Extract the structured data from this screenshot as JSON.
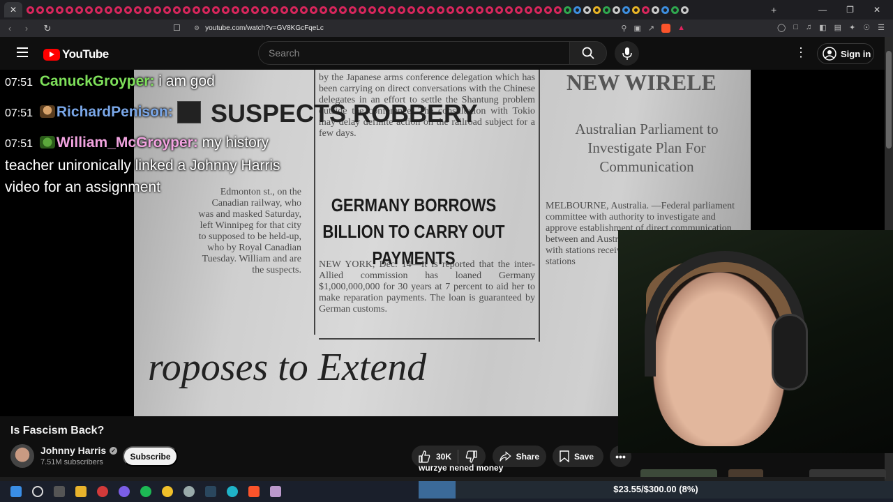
{
  "browser": {
    "tab_close": "✕",
    "new_tab": "+",
    "window_controls": [
      "—",
      "❐",
      "✕"
    ],
    "url": "youtube.com/watch?v=GV8KGcFqeLc"
  },
  "youtube": {
    "logo_text": "YouTube",
    "search_placeholder": "Search",
    "signin_label": "Sign in"
  },
  "chat": {
    "messages": [
      {
        "time": "07:51",
        "user": "CanuckGroyper:",
        "user_color": "#7ee05a",
        "text": "i am god"
      },
      {
        "time": "07:51",
        "user": "RichardPenison:",
        "user_color": "#7aa7e8",
        "text": ""
      },
      {
        "time": "07:51",
        "user": "William_McGroyper:",
        "user_color": "#f2a3e0",
        "text": "my history teacher unironically linked a Johnny Harris video for an assignment"
      }
    ]
  },
  "newspaper": {
    "headline": "GERMANY BORROWS BILLION TO CARRY OUT PAYMENTS",
    "big_text": "roposes to Extend",
    "left_head": "SUSPECTS ROBBERY",
    "right_head": "NEW WIRELE",
    "right_sub": "Australian Parliament to Investigate Plan For Communication",
    "col_top": "by the Japanese arms conference delegation which has been carrying on direct conversations with the Chinese delegates in an effort to settle the Shantung problem outside the conference. The consultation with Tokio may delay definite action on the railroad subject for a few days.",
    "col_body": "NEW YORK, Dec. 14—It is reported that the inter-Allied commission has loaned Germany $1,000,000,000 for 30 years at 7 percent to aid her to make reparation payments. The loan is guaranteed by German customs.",
    "col_left": "Edmonton st., on the Canadian railway, who was and masked Saturday, left Winnipeg for that city to supposed to be held-up, who by Royal Canadian Tuesday. William and are the suspects.",
    "col_right": "MELBOURNE, Australia. —Federal parliament committee with authority to investigate and approve establishment of direct communication between and Australia. taking has been facility with stations received round the world by the stations"
  },
  "video": {
    "title": "Is Fascism Back?",
    "channel": "Johnny Harris",
    "subscribers": "7.51M subscribers",
    "subscribe_label": "Subscribe",
    "likes": "30K",
    "share_label": "Share",
    "save_label": "Save",
    "more_label": "•••"
  },
  "stream": {
    "caption": "wurzye nened money",
    "donation_text": "$23.55/$300.00 (8%)",
    "donation_fraction": 0.0785
  }
}
